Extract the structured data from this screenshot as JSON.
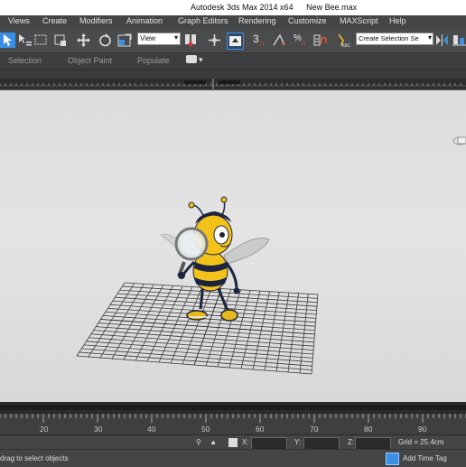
{
  "window": {
    "app_title": "Autodesk 3ds Max  2014 x64",
    "file_name": "New Bee.max"
  },
  "menu": [
    "Views",
    "Create",
    "Modifiers",
    "Animation",
    "Graph Editors",
    "Rendering",
    "Customize",
    "MAXScript",
    "Help"
  ],
  "toolbar": {
    "reference_coord": "View",
    "selection_set_placeholder": "Create Selection Se",
    "snap_3": "3",
    "snap_percent": "%"
  },
  "ribbon": {
    "tabs": [
      "Selection",
      "Object Paint",
      "Populate"
    ]
  },
  "timeline": {
    "ticks": [
      "20",
      "30",
      "40",
      "50",
      "60",
      "70",
      "80",
      "90"
    ]
  },
  "status": {
    "prompt": "drag to select objects",
    "x_label": "X:",
    "y_label": "Y:",
    "z_label": "Z:",
    "grid": "Grid = 25.4cm",
    "add_time_tag": "Add Time Tag"
  },
  "colors": {
    "accent": "#3a8ee6",
    "bee_yellow": "#f3c21a",
    "bee_dark": "#1d2440",
    "viewport_bg": "#e0e0e0"
  }
}
